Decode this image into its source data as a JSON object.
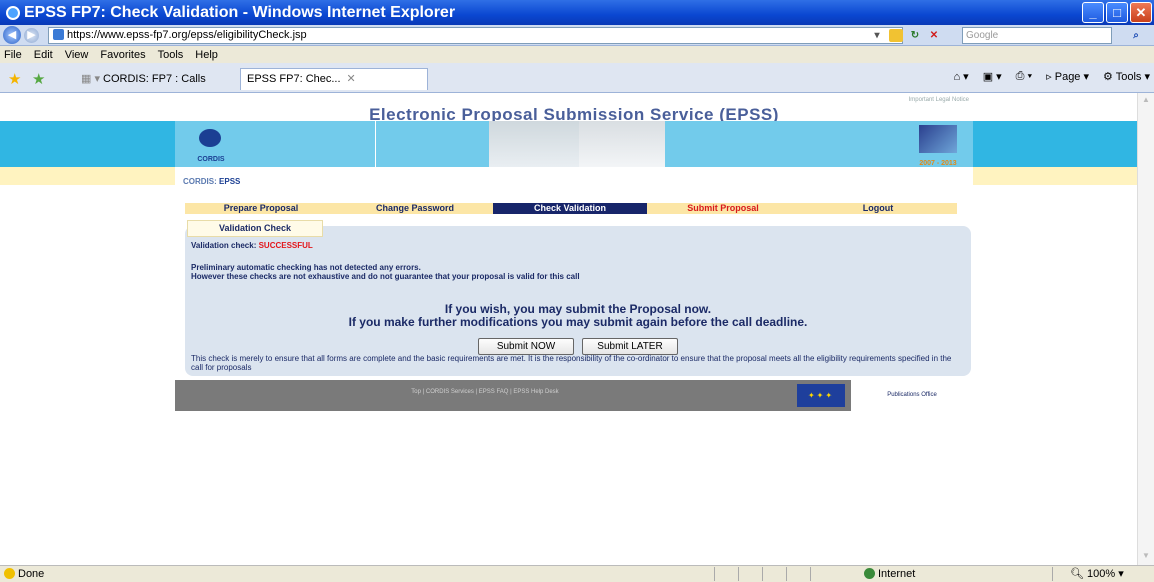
{
  "window": {
    "title": "EPSS FP7: Check Validation - Windows Internet Explorer"
  },
  "address_bar": {
    "url": "https://www.epss-fp7.org/epss/eligibilityCheck.jsp",
    "search_placeholder": "Google"
  },
  "menu": [
    "File",
    "Edit",
    "View",
    "Favorites",
    "Tools",
    "Help"
  ],
  "tabs": [
    {
      "label": "CORDIS: FP7 : Calls"
    },
    {
      "label": "EPSS FP7: Chec..."
    }
  ],
  "toolbar": {
    "page_label": "Page",
    "tools_label": "Tools"
  },
  "page": {
    "header_title": "Electronic Proposal Submission Service (EPSS)",
    "legal_notice": "Important Legal Notice",
    "cordis_logo": "CORDIS",
    "fp7_years": "2007 - 2013",
    "breadcrumb_parent": "CORDIS:",
    "breadcrumb_current": "EPSS",
    "nav": [
      {
        "label": "Prepare Proposal"
      },
      {
        "label": "Change Password"
      },
      {
        "label": "Check Validation"
      },
      {
        "label": "Submit Proposal"
      },
      {
        "label": "Logout"
      }
    ],
    "subtab": "Validation Check",
    "validation_label": "Validation check:",
    "validation_status": "SUCCESSFUL",
    "prelim_line1": "Preliminary automatic checking has not detected any errors.",
    "prelim_line2": "However these checks are not exhaustive and do not guarantee that your proposal is valid for this call",
    "wish_line1": "If you wish, you may submit the Proposal now.",
    "wish_line2": "If you make further modifications you may submit again before the call deadline.",
    "submit_now": "Submit NOW",
    "submit_later": "Submit LATER",
    "note": "This check is merely to ensure that all forms are complete and the basic requirements are met. It is the responsibility of the co-ordinator to ensure that the proposal meets all the eligibility requirements specified in the call for proposals",
    "footer_links": "Top | CORDIS Services | EPSS FAQ | EPSS Help Desk",
    "publications_office": "Publications Office"
  },
  "status": {
    "left": "Done",
    "zone": "Internet",
    "zoom": "100%"
  }
}
